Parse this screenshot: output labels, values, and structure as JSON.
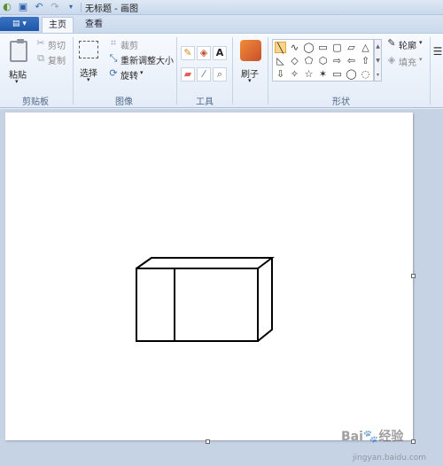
{
  "window": {
    "title": "无标题 - 画图"
  },
  "qat": {
    "save_icon": "save-icon",
    "undo_icon": "undo-icon",
    "redo_icon": "redo-icon",
    "customize_icon": "chevron-down-icon"
  },
  "tabs": {
    "file": "▤ ▾",
    "home": "主页",
    "view": "查看"
  },
  "clipboard": {
    "paste": "粘贴",
    "cut": "剪切",
    "copy": "复制",
    "group": "剪贴板"
  },
  "image": {
    "select": "选择",
    "crop": "裁剪",
    "resize": "重新调整大小",
    "rotate": "旋转",
    "group": "图像"
  },
  "tools": {
    "group": "工具",
    "text_glyph": "A"
  },
  "brushes": {
    "label": "刷子"
  },
  "shapes": {
    "outline": "轮廓",
    "fill": "填充",
    "group": "形状",
    "glyphs": [
      "╲",
      "∿",
      "◯",
      "▭",
      "▢",
      "▱",
      "△",
      "◺",
      "◇",
      "⬠",
      "⬡",
      "⇨",
      "⇦",
      "⇧",
      "⇩",
      "✧",
      "☆",
      "✶",
      "▭",
      "◯",
      "◌"
    ]
  },
  "watermark": {
    "brand": "Bai",
    "brand2": "经验",
    "url": "jingyan.baidu.com"
  },
  "colors": {
    "canvas": "#ffffff",
    "workspace": "#c6d3e5",
    "accent": "#2d5fa8"
  }
}
